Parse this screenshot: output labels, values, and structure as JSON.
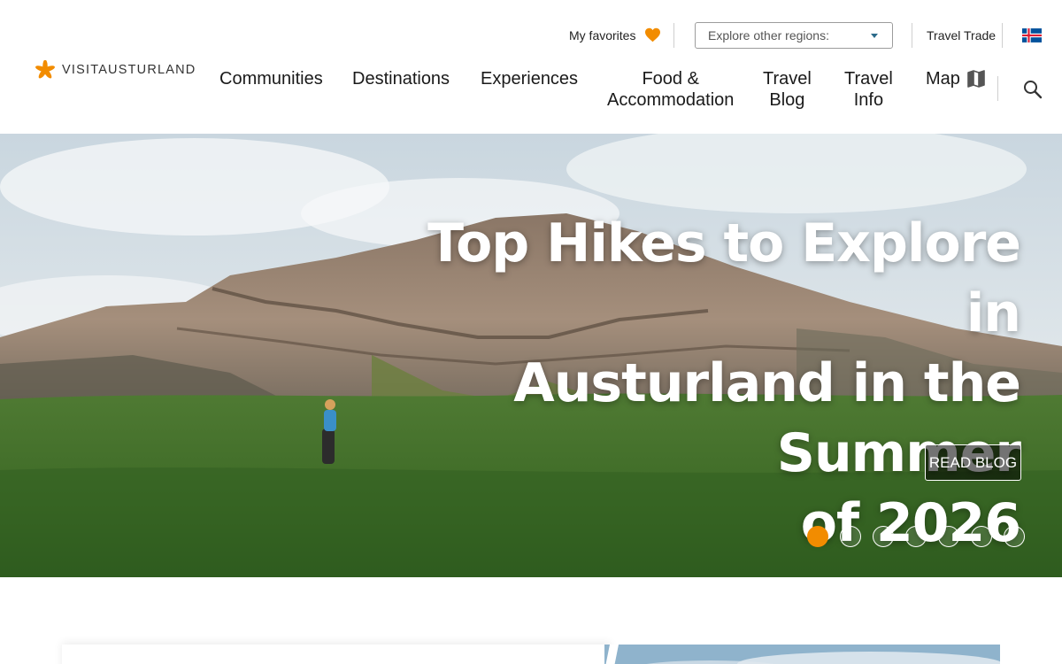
{
  "brand": {
    "logo_text_light": "VISIT",
    "logo_text": "AUSTURLAND",
    "accent": "#f28c00"
  },
  "utility": {
    "favorites_label": "My favorites",
    "favorites_icon": "heart-icon",
    "region_placeholder": "Explore other regions:",
    "travel_trade": "Travel Trade",
    "language_icon": "iceland-flag-icon"
  },
  "nav": {
    "communities": "Communities",
    "destinations": "Destinations",
    "experiences": "Experiences",
    "food_line1": "Food &",
    "food_line2": "Accommodation",
    "blog_line1": "Travel",
    "blog_line2": "Blog",
    "info_line1": "Travel",
    "info_line2": "Info",
    "map": "Map",
    "map_icon": "map-icon",
    "search_icon": "search-icon"
  },
  "hero": {
    "title_line1": "Top Hikes to Explore in",
    "title_line2": "Austurland in the Summer",
    "title_line3": "of 2026",
    "button_label": "READ BLOG",
    "slide_count": 7,
    "active_slide": 1
  }
}
